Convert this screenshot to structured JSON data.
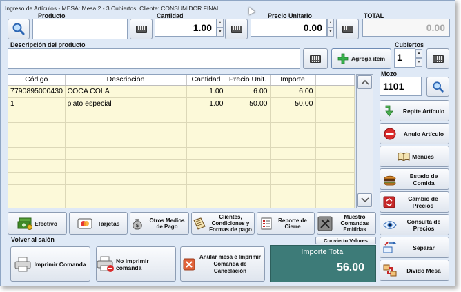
{
  "window": {
    "title": "Ingreso de Artículos - MESA: Mesa 2 - 3 Cubiertos, Cliente: CONSUMIDOR FINAL"
  },
  "labels": {
    "producto": "Producto",
    "cantidad": "Cantidad",
    "precio_unitario": "Precio Unitario",
    "total": "TOTAL",
    "descripcion_producto": "Descripción del producto",
    "cubiertos": "Cubiertos",
    "mozo": "Mozo",
    "volver": "Volver al salón"
  },
  "fields": {
    "producto": "",
    "cantidad": "1.00",
    "precio_unitario": "0.00",
    "total": "0.00",
    "descripcion": "",
    "cubiertos": "1",
    "mozo": "1101"
  },
  "buttons": {
    "agrega_item": "Agrega ítem",
    "efectivo": "Efectivo",
    "tarjetas": "Tarjetas",
    "otros_medios": "Otros Medios de Pago",
    "clientes": "Clientes, Condiciones y Formas de pago",
    "reporte_cierre": "Reporte de Cierre",
    "muestro_comandas": "Muestro Comandas Emitidas",
    "convierto_valores": "Convierto Valores",
    "imprimir_comanda": "Imprimir Comanda",
    "no_imprimir": "No imprimir comanda",
    "anular_mesa": "Anular mesa e Imprimir Comanda de Cancelación",
    "repite_articulo": "Repite Artículo",
    "anulo_articulo": "Anulo Artículo",
    "menues": "Menúes",
    "estado_comida": "Estado de Comida",
    "cambio_precios": "Cambio de Precios",
    "consulta_precios": "Consulta de Precios",
    "separar": "Separar",
    "divido_mesa": "Divido Mesa"
  },
  "table": {
    "headers": [
      "Código",
      "Descripción",
      "Cantidad",
      "Precio Unit.",
      "Importe",
      ""
    ],
    "rows": [
      [
        "7790895000430",
        "COCA COLA",
        "1.00",
        "6.00",
        "6.00",
        ""
      ],
      [
        "1",
        "plato especial",
        "1.00",
        "50.00",
        "50.00",
        ""
      ],
      [
        "",
        "",
        "",
        "",
        "",
        ""
      ],
      [
        "",
        "",
        "",
        "",
        "",
        ""
      ],
      [
        "",
        "",
        "",
        "",
        "",
        ""
      ],
      [
        "",
        "",
        "",
        "",
        "",
        ""
      ],
      [
        "",
        "",
        "",
        "",
        "",
        ""
      ],
      [
        "",
        "",
        "",
        "",
        "",
        ""
      ],
      [
        "",
        "",
        "",
        "",
        "",
        ""
      ],
      [
        "",
        "",
        "",
        "",
        "",
        ""
      ]
    ]
  },
  "importe_total": {
    "label": "Importe Total",
    "value": "56.00"
  },
  "colors": {
    "total_bg": "#3d7b78",
    "grid_row_bg": "#fcf9d9",
    "window_bg": "#dfe9f6"
  }
}
